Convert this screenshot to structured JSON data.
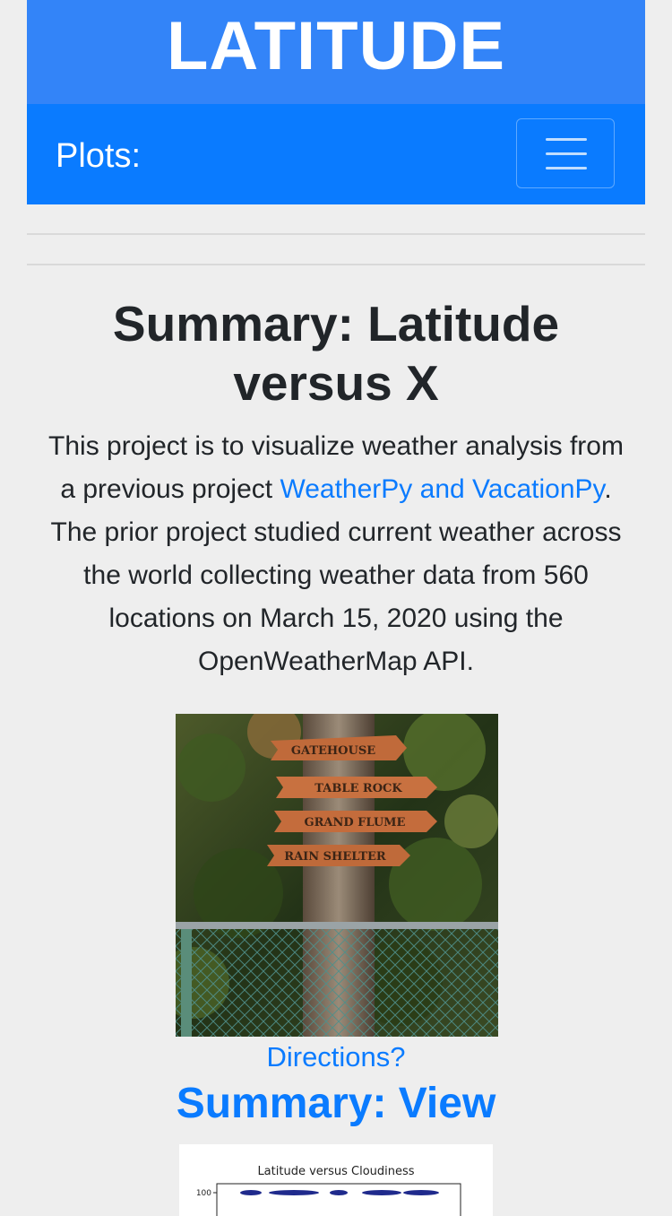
{
  "banner": {
    "title": "LATITUDE"
  },
  "navbar": {
    "brand": "Plots:",
    "toggle_icon": "hamburger-menu-icon"
  },
  "summary": {
    "title": "Summary: Latitude versus X",
    "intro_before": "This project is to visualize weather analysis from a previous project ",
    "intro_link": "WeatherPy and VacationPy",
    "intro_after": ". The prior project studied current weather across the world collecting weather data from 560 locations on March 15, 2020 using the OpenWeatherMap API."
  },
  "photo": {
    "signs": [
      "GATEHOUSE",
      "TABLE ROCK",
      "GRAND FLUME",
      "RAIN SHELTER"
    ],
    "caption": "Directions?"
  },
  "view": {
    "title": "Summary: View"
  },
  "chart_preview": {
    "title": "Latitude versus Cloudiness",
    "ytick": "100"
  },
  "colors": {
    "banner": "#3384f8",
    "navbar": "#0a7bff",
    "link": "#0a7bff",
    "background": "#eeeeee"
  }
}
